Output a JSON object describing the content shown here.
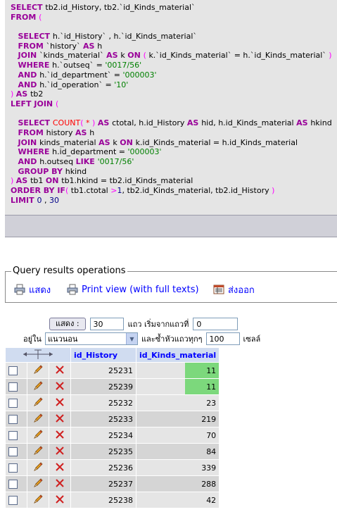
{
  "sql": {
    "lines": [
      [
        [
          "kw",
          "SELECT "
        ],
        [
          "id",
          "tb2.id_History, tb2.`id_Kinds_material`"
        ]
      ],
      [
        [
          "kw",
          "FROM "
        ],
        [
          "pu",
          "("
        ]
      ],
      [
        [
          "id",
          ""
        ]
      ],
      [
        [
          "id",
          "   "
        ],
        [
          "kw",
          "SELECT "
        ],
        [
          "id",
          "h.`id_History` , h.`id_Kinds_material`"
        ]
      ],
      [
        [
          "id",
          "   "
        ],
        [
          "kw",
          "FROM "
        ],
        [
          "id",
          "`history` "
        ],
        [
          "kw",
          "AS "
        ],
        [
          "id",
          "h"
        ]
      ],
      [
        [
          "id",
          "   "
        ],
        [
          "kw",
          "JOIN "
        ],
        [
          "id",
          "`kinds_material` "
        ],
        [
          "kw",
          "AS "
        ],
        [
          "id",
          "k "
        ],
        [
          "kw",
          "ON "
        ],
        [
          "pu",
          "( "
        ],
        [
          "id",
          "k.`id_Kinds_material` = h.`id_Kinds_material` "
        ],
        [
          "pu",
          ")"
        ]
      ],
      [
        [
          "id",
          "   "
        ],
        [
          "kw",
          "WHERE "
        ],
        [
          "id",
          "h.`outseq` = "
        ],
        [
          "str",
          "'0017/56'"
        ]
      ],
      [
        [
          "id",
          "   "
        ],
        [
          "kw",
          "AND "
        ],
        [
          "id",
          "h.`id_department` = "
        ],
        [
          "str",
          "'000003'"
        ]
      ],
      [
        [
          "id",
          "   "
        ],
        [
          "kw",
          "AND "
        ],
        [
          "id",
          "h.`id_operation` = "
        ],
        [
          "str",
          "'10'"
        ]
      ],
      [
        [
          "pu",
          ") "
        ],
        [
          "kw",
          "AS "
        ],
        [
          "id",
          "tb2"
        ]
      ],
      [
        [
          "kw",
          "LEFT JOIN "
        ],
        [
          "pu",
          "("
        ]
      ],
      [
        [
          "id",
          ""
        ]
      ],
      [
        [
          "id",
          "   "
        ],
        [
          "kw",
          "SELECT "
        ],
        [
          "fn",
          "COUNT"
        ],
        [
          "pu",
          "( "
        ],
        [
          "fn",
          "* "
        ],
        [
          "pu",
          ") "
        ],
        [
          "kw",
          "AS "
        ],
        [
          "id",
          "ctotal, h.id_History "
        ],
        [
          "kw",
          "AS "
        ],
        [
          "id",
          "hid, h.id_Kinds_material "
        ],
        [
          "kw",
          "AS "
        ],
        [
          "id",
          "hkind"
        ]
      ],
      [
        [
          "id",
          "   "
        ],
        [
          "kw",
          "FROM "
        ],
        [
          "id",
          "history "
        ],
        [
          "kw",
          "AS "
        ],
        [
          "id",
          "h"
        ]
      ],
      [
        [
          "id",
          "   "
        ],
        [
          "kw",
          "JOIN "
        ],
        [
          "id",
          "kinds_material "
        ],
        [
          "kw",
          "AS "
        ],
        [
          "id",
          "k "
        ],
        [
          "kw",
          "ON "
        ],
        [
          "id",
          "k.id_Kinds_material = h.id_Kinds_material"
        ]
      ],
      [
        [
          "id",
          "   "
        ],
        [
          "kw",
          "WHERE "
        ],
        [
          "id",
          "h.id_department = "
        ],
        [
          "str",
          "'000003'"
        ]
      ],
      [
        [
          "id",
          "   "
        ],
        [
          "kw",
          "AND "
        ],
        [
          "id",
          "h.outseq "
        ],
        [
          "kw",
          "LIKE "
        ],
        [
          "str",
          "'0017/56'"
        ]
      ],
      [
        [
          "id",
          "   "
        ],
        [
          "kw",
          "GROUP BY "
        ],
        [
          "id",
          "hkind"
        ]
      ],
      [
        [
          "pu",
          ") "
        ],
        [
          "kw",
          "AS "
        ],
        [
          "id",
          "tb1 "
        ],
        [
          "kw",
          "ON "
        ],
        [
          "id",
          "tb1.hkind = tb2.id_Kinds_material"
        ]
      ],
      [
        [
          "kw",
          "ORDER BY "
        ],
        [
          "kw",
          "IF"
        ],
        [
          "pu",
          "( "
        ],
        [
          "id",
          "tb1.ctotal "
        ],
        [
          "pu",
          ">"
        ],
        [
          "num",
          "1"
        ],
        [
          "id",
          ", tb2.id_Kinds_material, tb2.id_History "
        ],
        [
          "pu",
          ")"
        ]
      ],
      [
        [
          "kw",
          "LIMIT "
        ],
        [
          "num",
          "0 "
        ],
        [
          "id",
          ", "
        ],
        [
          "num",
          "30"
        ]
      ]
    ]
  },
  "operations": {
    "legend": "Query results operations",
    "print_label": "แสดง",
    "print_view_label": "Print view (with full texts)",
    "export_label": "ส่งออก"
  },
  "nav": {
    "show_button": "แสดง :",
    "rows_value": "30",
    "rows_text": "แถว เริ่มจากแถวที่",
    "start_value": "0",
    "in_label": "อยู่ใน",
    "mode_selected": "แนวนอน",
    "repeat_text": "และซ้ำหัวแถวทุกๆ",
    "repeat_value": "100",
    "cells_text": "เซลล์"
  },
  "table": {
    "columns": [
      "id_History",
      "id_Kinds_material"
    ],
    "rows": [
      {
        "id_History": "25231",
        "id_Kinds_material": "11",
        "highlight": true
      },
      {
        "id_History": "25239",
        "id_Kinds_material": "11",
        "highlight": true
      },
      {
        "id_History": "25232",
        "id_Kinds_material": "23",
        "highlight": false
      },
      {
        "id_History": "25233",
        "id_Kinds_material": "219",
        "highlight": false
      },
      {
        "id_History": "25234",
        "id_Kinds_material": "70",
        "highlight": false
      },
      {
        "id_History": "25235",
        "id_Kinds_material": "84",
        "highlight": false
      },
      {
        "id_History": "25236",
        "id_Kinds_material": "339",
        "highlight": false
      },
      {
        "id_History": "25237",
        "id_Kinds_material": "288",
        "highlight": false
      },
      {
        "id_History": "25238",
        "id_Kinds_material": "42",
        "highlight": false
      }
    ]
  },
  "colors": {
    "keyword": "#990099",
    "function": "#ff0000",
    "string": "#008000",
    "link": "#0000ff",
    "highlight": "#7cd87c"
  },
  "icons": {
    "print": "printer-icon",
    "print_view": "print-view-icon",
    "export": "export-icon",
    "edit": "pencil-icon",
    "delete": "delete-x-icon",
    "column_arrows": "left-right-arrows-icon"
  }
}
